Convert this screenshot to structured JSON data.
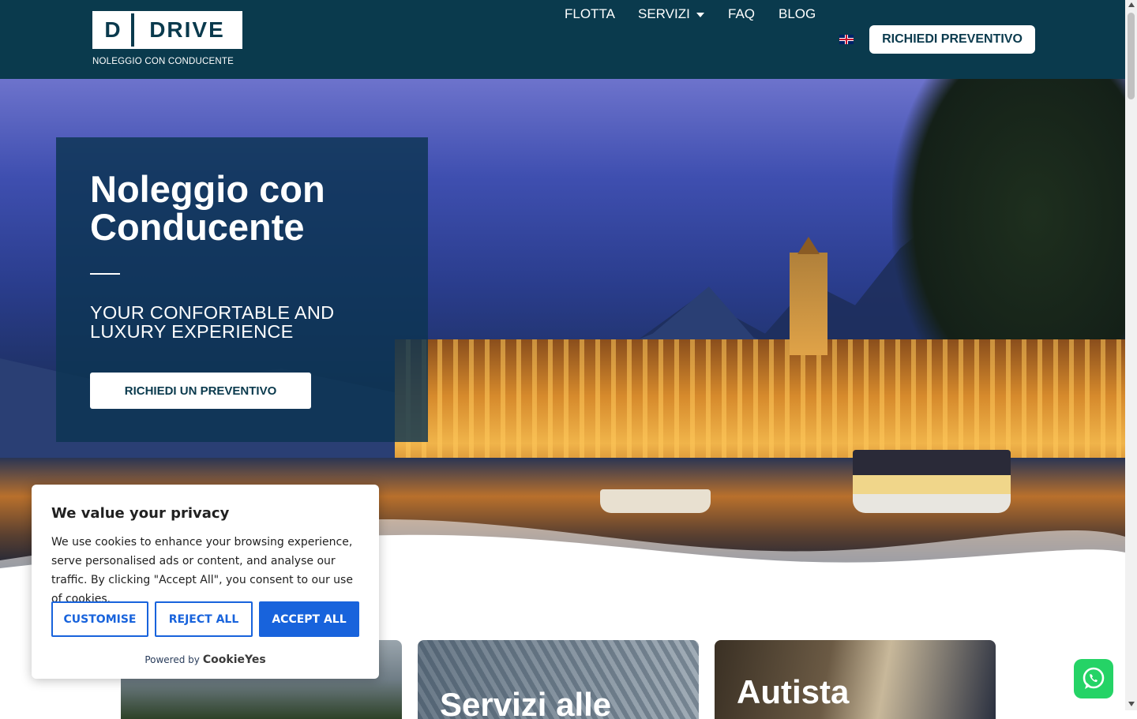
{
  "header": {
    "logo_letter": "D",
    "logo_name": "DRIVE",
    "logo_tagline": "NOLEGGIO CON CONDUCENTE",
    "nav": [
      {
        "label": "FLOTTA"
      },
      {
        "label": "SERVIZI"
      },
      {
        "label": "FAQ"
      },
      {
        "label": "BLOG"
      }
    ],
    "language_icon": "uk-flag-icon",
    "cta_label": "RICHIEDI PREVENTIVO"
  },
  "hero": {
    "title": "Noleggio con Conducente",
    "subtitle": "YOUR CONFORTABLE AND LUXURY EXPERIENCE",
    "cta_label": "RICHIEDI UN PREVENTIVO"
  },
  "services": [
    {
      "title": ""
    },
    {
      "title": "Servizi alle"
    },
    {
      "title": "Autista"
    }
  ],
  "cookie_banner": {
    "title": "We value your privacy",
    "text": "We use cookies to enhance your browsing experience, serve personalised ads or content, and analyse our traffic. By clicking \"Accept All\", you consent to our use of cookies.",
    "customise_label": "CUSTOMISE",
    "reject_label": "REJECT ALL",
    "accept_label": "ACCEPT ALL",
    "powered_by": "Powered by",
    "brand": "CookieYes"
  },
  "colors": {
    "header_bg": "#0a3a4d",
    "cookie_accent": "#1863dc",
    "whatsapp": "#25d366"
  }
}
